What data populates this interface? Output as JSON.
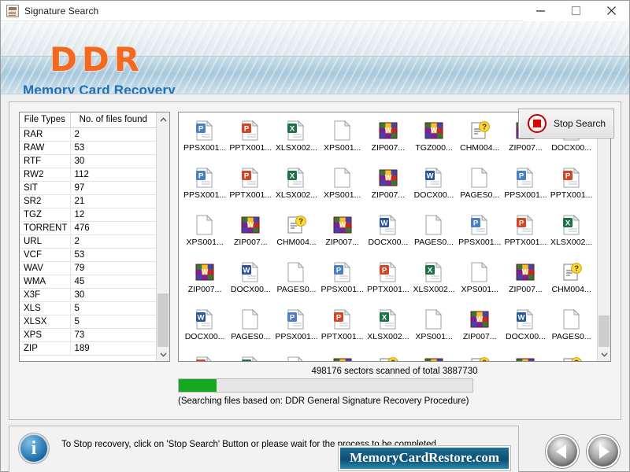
{
  "window": {
    "title": "Signature Search",
    "title_icon": "document-signature-icon",
    "minimize": "minimize-icon",
    "maximize": "maximize-icon",
    "close": "close-icon"
  },
  "header": {
    "logo": "DDR",
    "subtitle": "Memory Card Recovery",
    "logo_color": "#f26a21",
    "subtitle_color": "#1f6fb4"
  },
  "file_types_table": {
    "columns": [
      "File Types",
      "No. of files found"
    ],
    "rows": [
      [
        "RAR",
        "2"
      ],
      [
        "RAW",
        "53"
      ],
      [
        "RTF",
        "30"
      ],
      [
        "RW2",
        "112"
      ],
      [
        "SIT",
        "97"
      ],
      [
        "SR2",
        "21"
      ],
      [
        "TGZ",
        "12"
      ],
      [
        "TORRENT",
        "476"
      ],
      [
        "URL",
        "2"
      ],
      [
        "VCF",
        "53"
      ],
      [
        "WAV",
        "79"
      ],
      [
        "WMA",
        "45"
      ],
      [
        "X3F",
        "30"
      ],
      [
        "XLS",
        "5"
      ],
      [
        "XLSX",
        "5"
      ],
      [
        "XPS",
        "73"
      ],
      [
        "ZIP",
        "189"
      ]
    ]
  },
  "file_grid": {
    "items": [
      {
        "label": "PPSX001...",
        "icon": "ppsx-file-icon"
      },
      {
        "label": "PPTX001...",
        "icon": "pptx-file-icon"
      },
      {
        "label": "XLSX002...",
        "icon": "xlsx-file-icon"
      },
      {
        "label": "XPS001...",
        "icon": "blank-file-icon"
      },
      {
        "label": "ZIP007...",
        "icon": "zip-file-icon"
      },
      {
        "label": "TGZ000...",
        "icon": "zip-file-icon"
      },
      {
        "label": "CHM004...",
        "icon": "chm-file-icon"
      },
      {
        "label": "ZIP007...",
        "icon": "zip-file-icon"
      },
      {
        "label": "DOCX00...",
        "icon": "docx-file-icon"
      },
      {
        "label": "PPSX001...",
        "icon": "ppsx-file-icon"
      },
      {
        "label": "PPTX001...",
        "icon": "pptx-file-icon"
      },
      {
        "label": "XLSX002...",
        "icon": "xlsx-file-icon"
      },
      {
        "label": "XPS001...",
        "icon": "blank-file-icon"
      },
      {
        "label": "ZIP007...",
        "icon": "zip-file-icon"
      },
      {
        "label": "DOCX00...",
        "icon": "docx-file-icon"
      },
      {
        "label": "PAGES0...",
        "icon": "blank-file-icon"
      },
      {
        "label": "PPSX001...",
        "icon": "ppsx-file-icon"
      },
      {
        "label": "PPTX001...",
        "icon": "pptx-file-icon"
      },
      {
        "label": "XPS001...",
        "icon": "blank-file-icon"
      },
      {
        "label": "ZIP007...",
        "icon": "zip-file-icon"
      },
      {
        "label": "CHM004...",
        "icon": "chm-file-icon"
      },
      {
        "label": "ZIP007...",
        "icon": "zip-file-icon"
      },
      {
        "label": "DOCX00...",
        "icon": "docx-file-icon"
      },
      {
        "label": "PAGES0...",
        "icon": "blank-file-icon"
      },
      {
        "label": "PPSX001...",
        "icon": "ppsx-file-icon"
      },
      {
        "label": "PPTX001...",
        "icon": "pptx-file-icon"
      },
      {
        "label": "XLSX002...",
        "icon": "xlsx-file-icon"
      },
      {
        "label": "ZIP007...",
        "icon": "zip-file-icon"
      },
      {
        "label": "DOCX00...",
        "icon": "docx-file-icon"
      },
      {
        "label": "PAGES0...",
        "icon": "blank-file-icon"
      },
      {
        "label": "PPSX001...",
        "icon": "ppsx-file-icon"
      },
      {
        "label": "PPTX001...",
        "icon": "pptx-file-icon"
      },
      {
        "label": "XLSX002...",
        "icon": "xlsx-file-icon"
      },
      {
        "label": "XPS001...",
        "icon": "blank-file-icon"
      },
      {
        "label": "ZIP007...",
        "icon": "zip-file-icon"
      },
      {
        "label": "CHM004...",
        "icon": "chm-file-icon"
      },
      {
        "label": "DOCX00...",
        "icon": "docx-file-icon"
      },
      {
        "label": "PAGES0...",
        "icon": "blank-file-icon"
      },
      {
        "label": "PPSX001...",
        "icon": "ppsx-file-icon"
      },
      {
        "label": "PPTX001...",
        "icon": "pptx-file-icon"
      },
      {
        "label": "XLSX002...",
        "icon": "xlsx-file-icon"
      },
      {
        "label": "XPS001...",
        "icon": "blank-file-icon"
      },
      {
        "label": "ZIP007...",
        "icon": "zip-file-icon"
      },
      {
        "label": "DOCX00...",
        "icon": "docx-file-icon"
      },
      {
        "label": "PAGES0...",
        "icon": "blank-file-icon"
      },
      {
        "label": "",
        "icon": "pptx-file-icon"
      },
      {
        "label": "",
        "icon": "xlsx-file-icon"
      },
      {
        "label": "",
        "icon": "blank-file-icon"
      },
      {
        "label": "",
        "icon": "zip-file-icon"
      },
      {
        "label": "",
        "icon": "chm-file-icon"
      },
      {
        "label": "",
        "icon": "zip-file-icon"
      },
      {
        "label": "",
        "icon": "chm-file-icon"
      },
      {
        "label": "",
        "icon": "zip-file-icon"
      },
      {
        "label": "",
        "icon": "chm-file-icon"
      }
    ]
  },
  "progress": {
    "sectors_text": "498176 sectors scanned of total 3887730",
    "sectors_scanned": 498176,
    "sectors_total": 3887730,
    "percent": 12.8,
    "fill_color": "#16a821",
    "note": "(Searching files based on:  DDR General Signature Recovery Procedure)"
  },
  "stop_button": {
    "label": "Stop Search",
    "icon": "stop-square-icon"
  },
  "status": {
    "icon": "info-icon",
    "message": "To Stop recovery, click on 'Stop Search' Button or please wait for the process to be completed.",
    "brand": "MemoryCardRestore.com"
  },
  "nav": {
    "back": "back-arrow-icon",
    "next": "next-arrow-icon"
  }
}
